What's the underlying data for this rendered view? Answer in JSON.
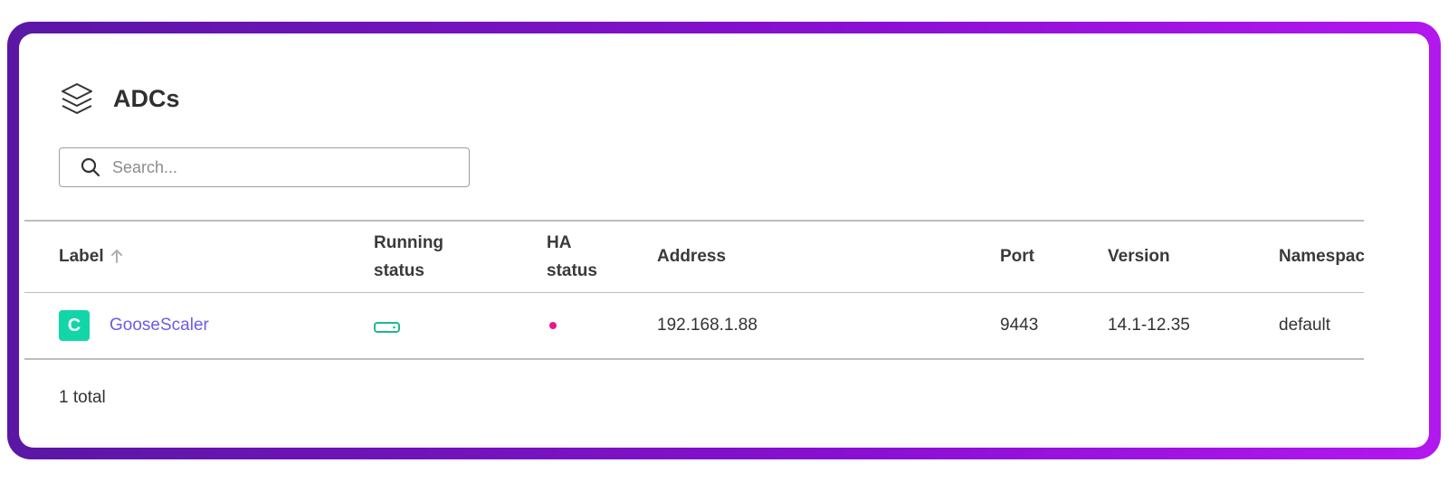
{
  "header": {
    "title": "ADCs",
    "icon": "layers-icon"
  },
  "search": {
    "placeholder": "Search...",
    "value": "",
    "icon": "search-icon"
  },
  "table": {
    "columns": {
      "label": "Label",
      "running_status": "Running\nstatus",
      "ha_status": "HA\nstatus",
      "address": "Address",
      "port": "Port",
      "version": "Version",
      "namespace": "Namespac"
    },
    "sort": {
      "column": "label",
      "direction": "ascending",
      "icon": "arrow-up-icon"
    },
    "rows": [
      {
        "badge": "C",
        "label": "GooseScaler",
        "running_status_icon": "server-status-icon",
        "ha_status_icon": "status-dot-icon",
        "address": "192.168.1.88",
        "port": "9443",
        "version": "14.1-12.35",
        "namespace": "default"
      }
    ]
  },
  "footer": {
    "total": "1 total"
  },
  "colors": {
    "frame_start": "#5a17a4",
    "frame_end": "#b317ef",
    "link": "#6c5ce7",
    "badge": "#12d6a8",
    "running_status": "#1fb98f",
    "ha_status": "#e6198c"
  }
}
